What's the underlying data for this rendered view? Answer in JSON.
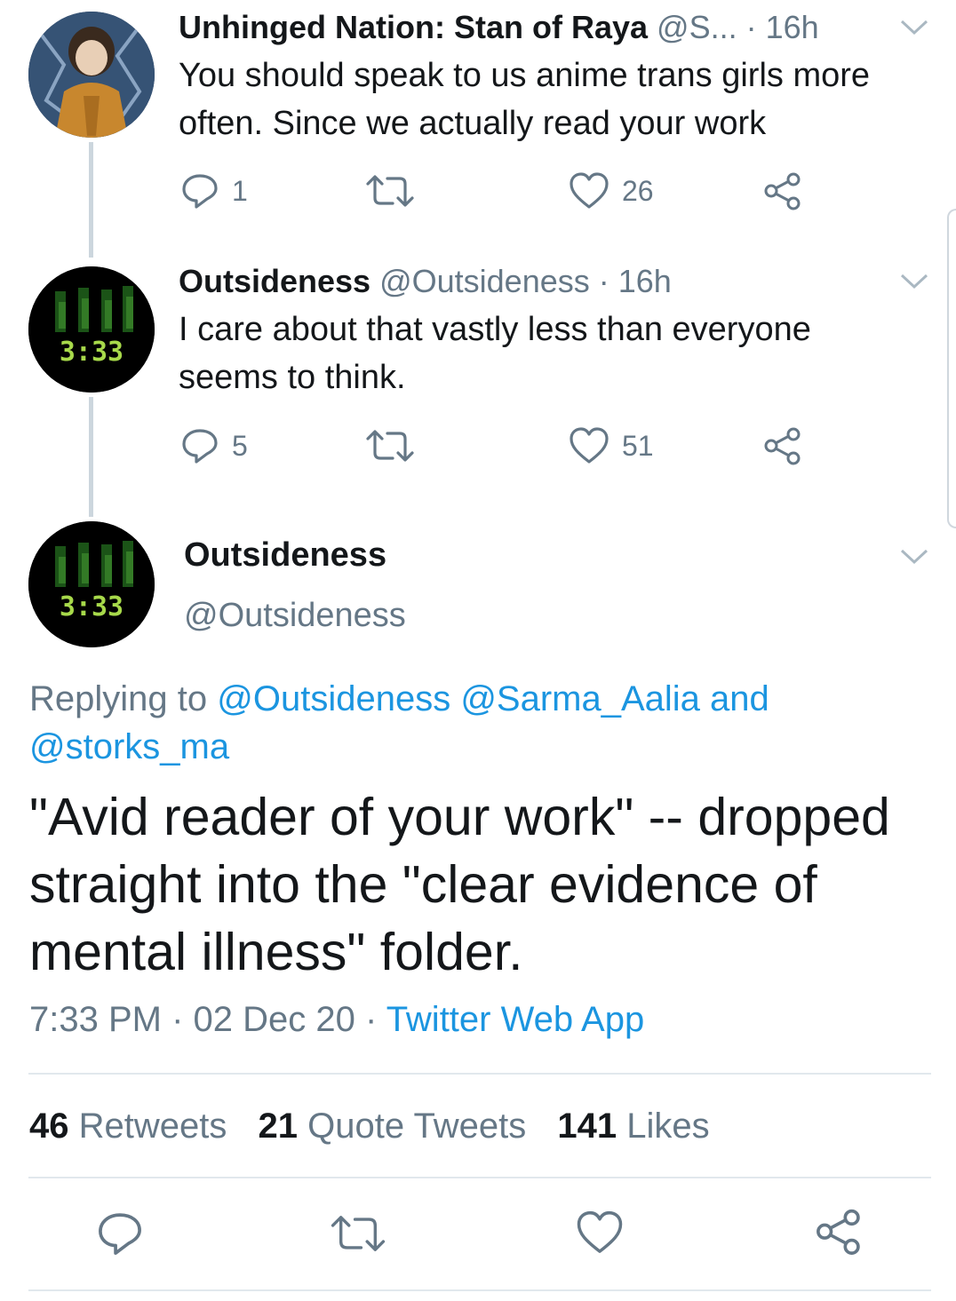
{
  "tweets": [
    {
      "display_name": "Unhinged Nation: Stan of Raya",
      "handle": "@S...",
      "time": "· 16h",
      "text": "You should speak to us anime trans girls more often. Since we actually read your work",
      "replies": "1",
      "retweets": "",
      "likes": "26"
    },
    {
      "display_name": "Outsideness",
      "handle": "@Outsideness",
      "time": "· 16h",
      "text": "I care about that vastly less than everyone seems to think.",
      "replies": "5",
      "retweets": "",
      "likes": "51"
    }
  ],
  "main_tweet": {
    "display_name": "Outsideness",
    "handle": "@Outsideness",
    "replying_prefix": "Replying to",
    "replying_users_line1": "@Outsideness @Sarma_Aalia and",
    "replying_users_line2": "@storks_ma",
    "text": "\"Avid reader of your work\" -- dropped straight into the \"clear evidence of mental illness\" folder.",
    "time": "7:33 PM · 02 Dec 20 ·",
    "source": "Twitter Web App",
    "stats": {
      "retweets_count": "46",
      "retweets_label": "Retweets",
      "quotes_count": "21",
      "quotes_label": "Quote Tweets",
      "likes_count": "141",
      "likes_label": "Likes"
    }
  },
  "avatar_clock_text": "3:33",
  "icons": [
    "reply-icon",
    "retweet-icon",
    "like-icon",
    "share-icon",
    "chevron-down-icon"
  ],
  "colors": {
    "link": "#1b95e0",
    "muted": "#657786",
    "divider": "#e1e8ed",
    "thread_line": "#ccd6dd"
  }
}
